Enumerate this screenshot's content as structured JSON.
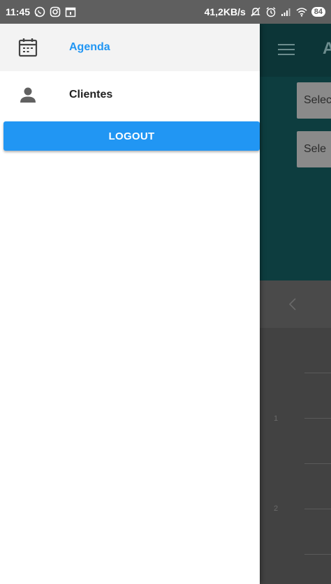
{
  "status_bar": {
    "time": "11:45",
    "network_speed": "41,2KB/s",
    "battery": "84",
    "icons_left": [
      "whatsapp-icon",
      "instagram-icon",
      "calendar-notification-icon"
    ],
    "icons_right": [
      "notifications-off-icon",
      "alarm-icon",
      "signal-icon",
      "wifi-icon"
    ]
  },
  "drawer": {
    "items": [
      {
        "label": "Agenda",
        "icon": "calendar-icon",
        "active": true
      },
      {
        "label": "Clientes",
        "icon": "person-icon",
        "active": false
      }
    ],
    "logout_label": "LOGOUT"
  },
  "background_app": {
    "title_peek": "A",
    "select_1": "Selec",
    "select_2": "Sele",
    "grid_numbers": [
      "1",
      "2"
    ]
  },
  "colors": {
    "accent": "#2196f3",
    "drawer_bg": "#ffffff",
    "active_item_bg": "#f3f3f3",
    "status_bar": "#5f5f5f"
  }
}
